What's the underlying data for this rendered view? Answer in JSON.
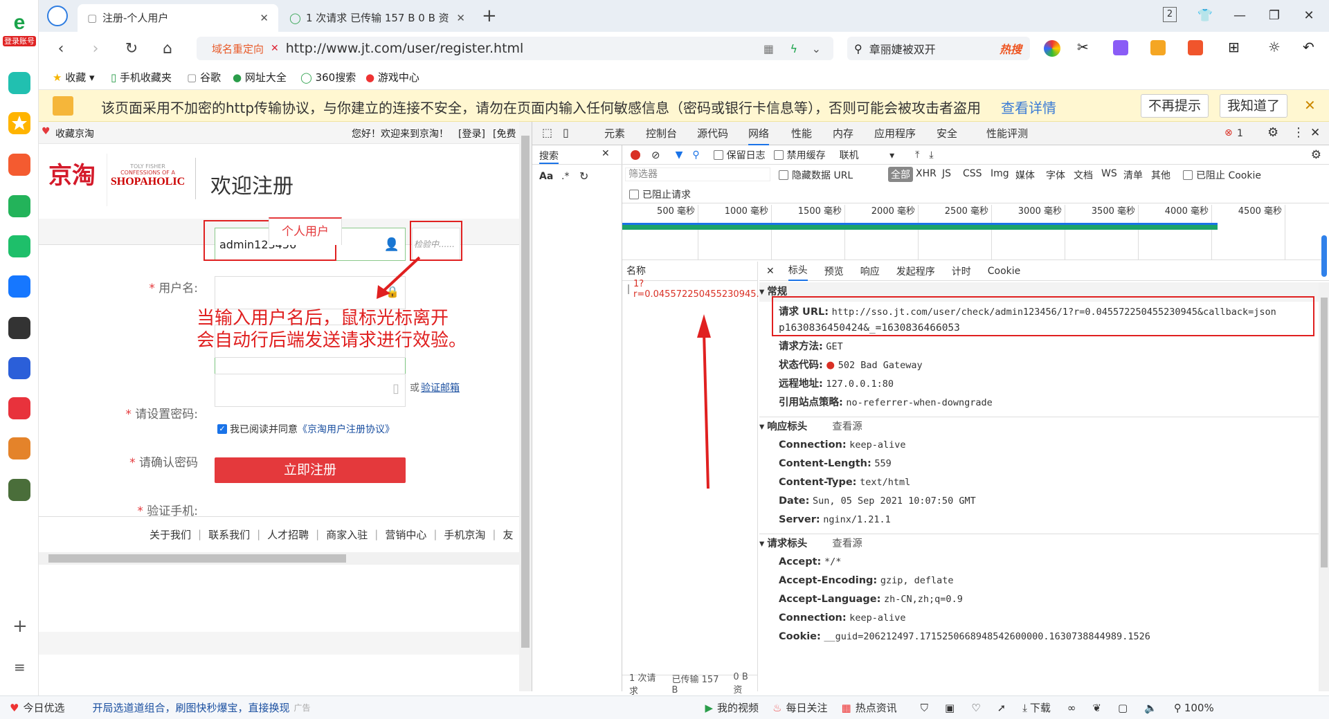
{
  "app": {
    "login_badge": "登录账号"
  },
  "tabs": [
    {
      "label": "注册-个人用户",
      "active": true
    },
    {
      "label": "1 次请求 已传输 157 B 0 B 资",
      "active": false
    }
  ],
  "window": {
    "tab_count": "2"
  },
  "address": {
    "redirect_label": "域名重定向",
    "url": "http://www.jt.com/user/register.html",
    "search_value": "章丽婕被双开",
    "hot_label": "热搜"
  },
  "bookmarks": [
    {
      "label": "收藏"
    },
    {
      "label": "手机收藏夹"
    },
    {
      "label": "谷歌"
    },
    {
      "label": "网址大全"
    },
    {
      "label": "360搜索"
    },
    {
      "label": "游戏中心"
    }
  ],
  "warning": {
    "text": "该页面采用不加密的http传输协议，与你建立的连接不安全，请勿在页面内输入任何敏感信息（密码或银行卡信息等），否则可能会被攻击者盗用",
    "details_link": "查看详情",
    "no_remind": "不再提示",
    "got_it": "我知道了"
  },
  "page": {
    "fav_label": "收藏京淘",
    "greeting": "您好！欢迎来到京淘！",
    "login_link": "[登录]",
    "free_link": "[免费",
    "logo_text": "京淘",
    "banner_top": "TOLY FISHER",
    "banner_mid": "CONFESSIONS OF A",
    "banner_bottom": "SHOPAHOLIC",
    "welcome": "欢迎注册",
    "tab_personal": "个人用户",
    "form": {
      "username_label": "用户名:",
      "username_value": "admin123456",
      "checking": "检验中......",
      "password_label": "请设置密码:",
      "confirm_label": "请确认密码",
      "phone_label": "验证手机:",
      "or": "或",
      "email_link": "验证邮箱",
      "agree_prefix": "我已阅读并同意",
      "agree_link": "《京淘用户注册协议》",
      "submit": "立即注册"
    },
    "annotation_line1": "当输入用户名后，鼠标光标离开",
    "annotation_line2": "会自动行后端发送请求进行效验。",
    "footer": [
      "关于我们",
      "联系我们",
      "人才招聘",
      "商家入驻",
      "营销中心",
      "手机京淘",
      "友"
    ]
  },
  "devtools": {
    "tabs": [
      "元素",
      "控制台",
      "源代码",
      "网络",
      "性能",
      "内存",
      "应用程序",
      "安全",
      "性能评测"
    ],
    "active_tab": "网络",
    "error_count": "1",
    "search_tab": "搜索",
    "search_aa": "Aa",
    "search_regex": ".*",
    "toolbar": {
      "preserve_log": "保留日志",
      "disable_cache": "禁用缓存",
      "throttle": "联机"
    },
    "filter": {
      "placeholder": "筛选器",
      "hide_data_url": "隐藏数据 URL",
      "types": [
        "全部",
        "XHR",
        "JS",
        "CSS",
        "Img",
        "媒体",
        "字体",
        "文档",
        "WS",
        "清单",
        "其他"
      ],
      "blocked_cookies": "已阻止 Cookie",
      "blocked_requests": "已阻止请求"
    },
    "timeline_ticks": [
      "500 毫秒",
      "1000 毫秒",
      "1500 毫秒",
      "2000 毫秒",
      "2500 毫秒",
      "3000 毫秒",
      "3500 毫秒",
      "4000 毫秒",
      "4500 毫秒",
      "500"
    ],
    "name_header": "名称",
    "request_name": "1?r=0.045572250455230945...",
    "detail_tabs": [
      "标头",
      "预览",
      "响应",
      "发起程序",
      "计时",
      "Cookie"
    ],
    "general": {
      "title": "常规",
      "url_label": "请求 URL:",
      "url_line1": "http://sso.jt.com/user/check/admin123456/1?r=0.045572250455230945&callback=json",
      "url_line2": "p1630836450424&_=1630836466053",
      "method_label": "请求方法:",
      "method": "GET",
      "status_label": "状态代码:",
      "status": "502 Bad Gateway",
      "remote_label": "远程地址:",
      "remote": "127.0.0.1:80",
      "referrer_label": "引用站点策略:",
      "referrer": "no-referrer-when-downgrade"
    },
    "response_headers": {
      "title": "响应标头",
      "view_source": "查看源",
      "rows": [
        {
          "k": "Connection:",
          "v": "keep-alive"
        },
        {
          "k": "Content-Length:",
          "v": "559"
        },
        {
          "k": "Content-Type:",
          "v": "text/html"
        },
        {
          "k": "Date:",
          "v": "Sun, 05 Sep 2021 10:07:50 GMT"
        },
        {
          "k": "Server:",
          "v": "nginx/1.21.1"
        }
      ]
    },
    "request_headers": {
      "title": "请求标头",
      "view_source": "查看源",
      "rows": [
        {
          "k": "Accept:",
          "v": "*/*"
        },
        {
          "k": "Accept-Encoding:",
          "v": "gzip, deflate"
        },
        {
          "k": "Accept-Language:",
          "v": "zh-CN,zh;q=0.9"
        },
        {
          "k": "Connection:",
          "v": "keep-alive"
        },
        {
          "k": "Cookie:",
          "v": "__guid=206212497.1715250668948542600000.1630738844989.1526"
        }
      ]
    },
    "status_bar": {
      "requests": "1 次请求",
      "transferred": "已传输 157 B",
      "resources": "0 B 资"
    }
  },
  "statusbar": {
    "left": "今日优选",
    "promo": "开局选道道组合，刷图快秒爆宝，直接换现",
    "ad": "广告",
    "my_video": "我的视频",
    "daily": "每日关注",
    "hot_news": "热点资讯",
    "download": "下载",
    "zoom": "100%"
  },
  "colors": {
    "accent": "#e4393c",
    "link": "#1a4fa0",
    "dev_blue": "#1a73e8",
    "annotation": "#e02020"
  }
}
